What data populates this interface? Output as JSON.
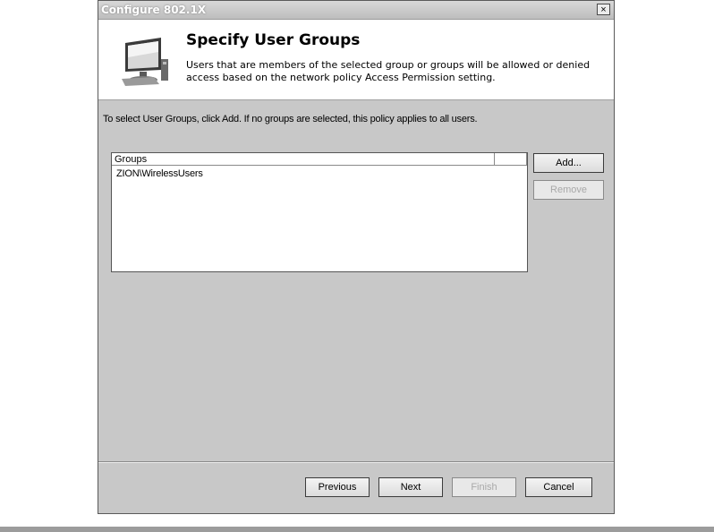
{
  "window": {
    "title": "Configure 802.1X",
    "close_label": "×"
  },
  "header": {
    "title": "Specify User Groups",
    "description": "Users that are members of the selected group or groups will be allowed or denied access based on the network policy Access Permission setting.",
    "icon": "computer-monitor-icon"
  },
  "main": {
    "instruction": "To select User Groups, click Add. If no groups are selected, this policy applies to all users.",
    "groups_list": {
      "columns": [
        "Groups",
        ""
      ],
      "rows": [
        {
          "name": "ZION\\WirelessUsers"
        }
      ]
    },
    "add_button": "Add...",
    "remove_button": "Remove"
  },
  "footer": {
    "previous": "Previous",
    "next": "Next",
    "finish": "Finish",
    "cancel": "Cancel"
  }
}
